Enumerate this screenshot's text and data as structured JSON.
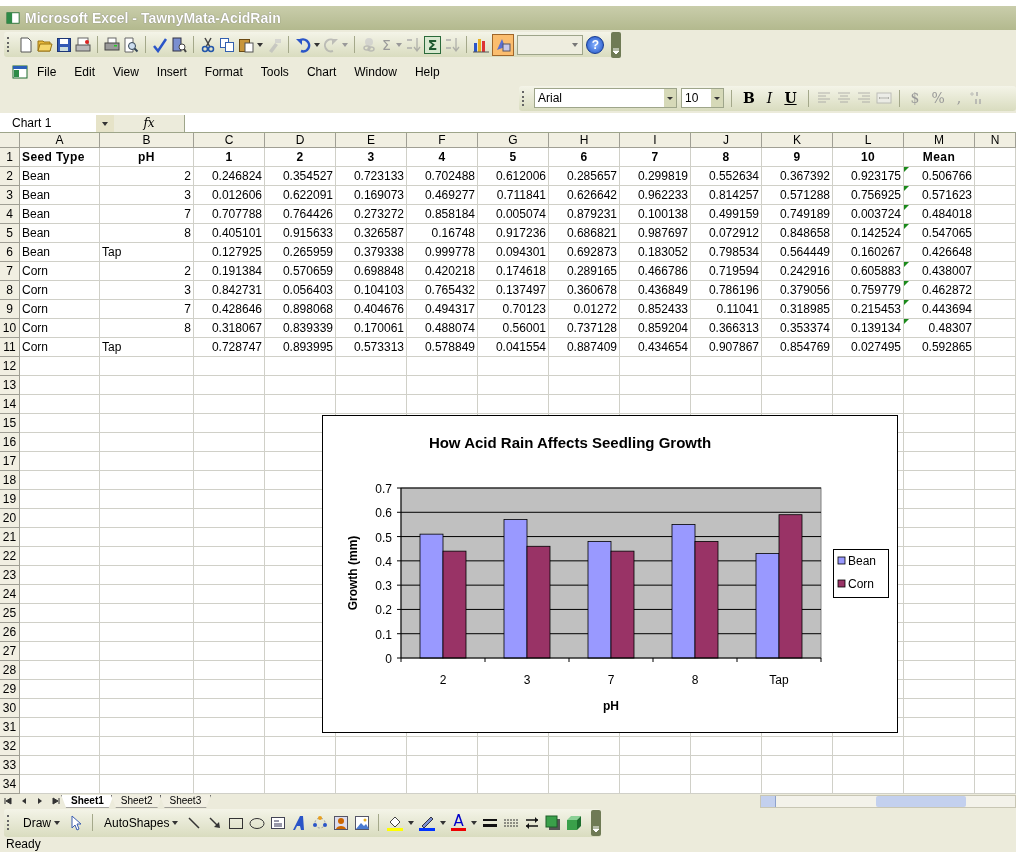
{
  "window": {
    "title": "Microsoft Excel - TawnyMata-AcidRain"
  },
  "standard_toolbar": {
    "autosum": "Σ",
    "insert_function": "Σ",
    "help": "?"
  },
  "menu": [
    "File",
    "Edit",
    "View",
    "Insert",
    "Format",
    "Tools",
    "Chart",
    "Window",
    "Help"
  ],
  "format_toolbar": {
    "font": "Arial",
    "size": "10",
    "bold": "B",
    "italic": "I",
    "underline": "U",
    "currency": "$",
    "percent": "%",
    "comma": ","
  },
  "formula_bar": {
    "name_box": "Chart 1",
    "fx": "fx"
  },
  "sheet": {
    "columns": [
      "A",
      "B",
      "C",
      "D",
      "E",
      "F",
      "G",
      "H",
      "I",
      "J",
      "K",
      "L",
      "M",
      "N"
    ],
    "rows": [
      {
        "num": "1",
        "kind": "header",
        "flagged": false,
        "cells": [
          "Seed Type",
          "pH",
          "1",
          "2",
          "3",
          "4",
          "5",
          "6",
          "7",
          "8",
          "9",
          "10",
          "Mean"
        ]
      },
      {
        "num": "2",
        "kind": "data",
        "flagged": true,
        "cells": [
          "Bean",
          "2",
          "0.246824",
          "0.354527",
          "0.723133",
          "0.702488",
          "0.612006",
          "0.285657",
          "0.299819",
          "0.552634",
          "0.367392",
          "0.923175",
          "0.506766"
        ]
      },
      {
        "num": "3",
        "kind": "data",
        "flagged": true,
        "cells": [
          "Bean",
          "3",
          "0.012606",
          "0.622091",
          "0.169073",
          "0.469277",
          "0.711841",
          "0.626642",
          "0.962233",
          "0.814257",
          "0.571288",
          "0.756925",
          "0.571623"
        ]
      },
      {
        "num": "4",
        "kind": "data",
        "flagged": true,
        "cells": [
          "Bean",
          "7",
          "0.707788",
          "0.764426",
          "0.273272",
          "0.858184",
          "0.005074",
          "0.879231",
          "0.100138",
          "0.499159",
          "0.749189",
          "0.003724",
          "0.484018"
        ]
      },
      {
        "num": "5",
        "kind": "data",
        "flagged": true,
        "cells": [
          "Bean",
          "8",
          "0.405101",
          "0.915633",
          "0.326587",
          "0.16748",
          "0.917236",
          "0.686821",
          "0.987697",
          "0.072912",
          "0.848658",
          "0.142524",
          "0.547065"
        ]
      },
      {
        "num": "6",
        "kind": "data",
        "flagged": false,
        "cells": [
          "Bean",
          "Tap",
          "0.127925",
          "0.265959",
          "0.379338",
          "0.999778",
          "0.094301",
          "0.692873",
          "0.183052",
          "0.798534",
          "0.564449",
          "0.160267",
          "0.426648"
        ]
      },
      {
        "num": "7",
        "kind": "data",
        "flagged": true,
        "cells": [
          "Corn",
          "2",
          "0.191384",
          "0.570659",
          "0.698848",
          "0.420218",
          "0.174618",
          "0.289165",
          "0.466786",
          "0.719594",
          "0.242916",
          "0.605883",
          "0.438007"
        ]
      },
      {
        "num": "8",
        "kind": "data",
        "flagged": true,
        "cells": [
          "Corn",
          "3",
          "0.842731",
          "0.056403",
          "0.104103",
          "0.765432",
          "0.137497",
          "0.360678",
          "0.436849",
          "0.786196",
          "0.379056",
          "0.759779",
          "0.462872"
        ]
      },
      {
        "num": "9",
        "kind": "data",
        "flagged": true,
        "cells": [
          "Corn",
          "7",
          "0.428646",
          "0.898068",
          "0.404676",
          "0.494317",
          "0.70123",
          "0.01272",
          "0.852433",
          "0.11041",
          "0.318985",
          "0.215453",
          "0.443694"
        ]
      },
      {
        "num": "10",
        "kind": "data",
        "flagged": true,
        "cells": [
          "Corn",
          "8",
          "0.318067",
          "0.839339",
          "0.170061",
          "0.488074",
          "0.56001",
          "0.737128",
          "0.859204",
          "0.366313",
          "0.353374",
          "0.139134",
          "0.48307"
        ]
      },
      {
        "num": "11",
        "kind": "data",
        "flagged": false,
        "cells": [
          "Corn",
          "Tap",
          "0.728747",
          "0.893995",
          "0.573313",
          "0.578849",
          "0.041554",
          "0.887409",
          "0.434654",
          "0.907867",
          "0.854769",
          "0.027495",
          "0.592865"
        ]
      }
    ],
    "empty_rows": [
      "12",
      "13",
      "14",
      "15",
      "16",
      "17",
      "18",
      "19",
      "20",
      "21",
      "22",
      "23",
      "24",
      "25",
      "26",
      "27",
      "28",
      "29",
      "30",
      "31",
      "32",
      "33",
      "34"
    ],
    "chart_data": {
      "type": "bar",
      "title": "How Acid Rain Affects Seedling Growth",
      "xlabel": "pH",
      "ylabel": "Growth (mm)",
      "categories": [
        "2",
        "3",
        "7",
        "8",
        "Tap"
      ],
      "series": [
        {
          "name": "Bean",
          "color": "#9999ff",
          "values": [
            0.51,
            0.57,
            0.48,
            0.55,
            0.43
          ]
        },
        {
          "name": "Corn",
          "color": "#993366",
          "values": [
            0.44,
            0.46,
            0.44,
            0.48,
            0.59
          ]
        }
      ],
      "grid": true,
      "legend": "right",
      "ylim": [
        0,
        0.7
      ],
      "yticks": [
        {
          "value": 0,
          "label": "0"
        },
        {
          "value": 0.1,
          "label": "0.1"
        },
        {
          "value": 0.2,
          "label": "0.2"
        },
        {
          "value": 0.3,
          "label": "0.3"
        },
        {
          "value": 0.4,
          "label": "0.4"
        },
        {
          "value": 0.5,
          "label": "0.5"
        },
        {
          "value": 0.6,
          "label": "0.6"
        },
        {
          "value": 0.7,
          "label": "0.7"
        }
      ]
    }
  },
  "sheet_tabs": [
    {
      "label": "Sheet1",
      "selected": true
    },
    {
      "label": "Sheet2",
      "selected": false
    },
    {
      "label": "Sheet3",
      "selected": false
    }
  ],
  "draw_toolbar": {
    "draw": "Draw",
    "autoshapes": "AutoShapes",
    "font_color": "A"
  },
  "status_bar": {
    "text": "Ready"
  }
}
